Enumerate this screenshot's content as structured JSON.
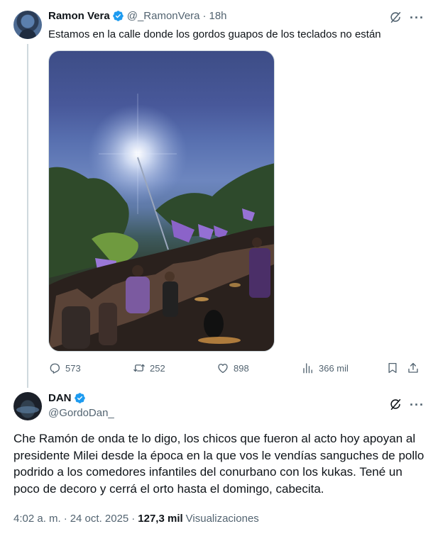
{
  "tweet": {
    "author_name": "Ramon Vera",
    "author_handle": "@_RamonVera",
    "separator": "·",
    "time": "18h",
    "text": "Estamos en la calle donde los gordos guapos de los teclados no están",
    "stats": {
      "replies": "573",
      "reposts": "252",
      "likes": "898",
      "views": "366 mil"
    }
  },
  "reply": {
    "author_name": "DAN",
    "author_handle": "@GordoDan_",
    "text": "Che Ramón de onda te lo digo, los chicos que fueron al acto hoy apoyan al presidente Milei desde la época en la que vos le vendías sanguches de pollo podrido a los comedores infantiles del conurbano con los kukas. Tené un poco de decoro y cerrá el orto hasta el domingo, cabecita.",
    "time": "4:02 a. m.",
    "separator": "·",
    "date": "24 oct. 2025",
    "separator2": "·",
    "views_count": "127,3 mil",
    "views_label": "Visualizaciones"
  },
  "icons": {
    "verified": "verified-badge-icon",
    "grok": "grok-icon",
    "more": "more-icon",
    "reply": "reply-icon",
    "repost": "repost-icon",
    "like": "like-icon",
    "views": "views-icon",
    "bookmark": "bookmark-icon",
    "share": "share-icon"
  },
  "colors": {
    "verified_blue": "#1d9bf0",
    "secondary_text": "#536471",
    "primary_text": "#0f1419",
    "thread_line": "#cfd9de"
  }
}
